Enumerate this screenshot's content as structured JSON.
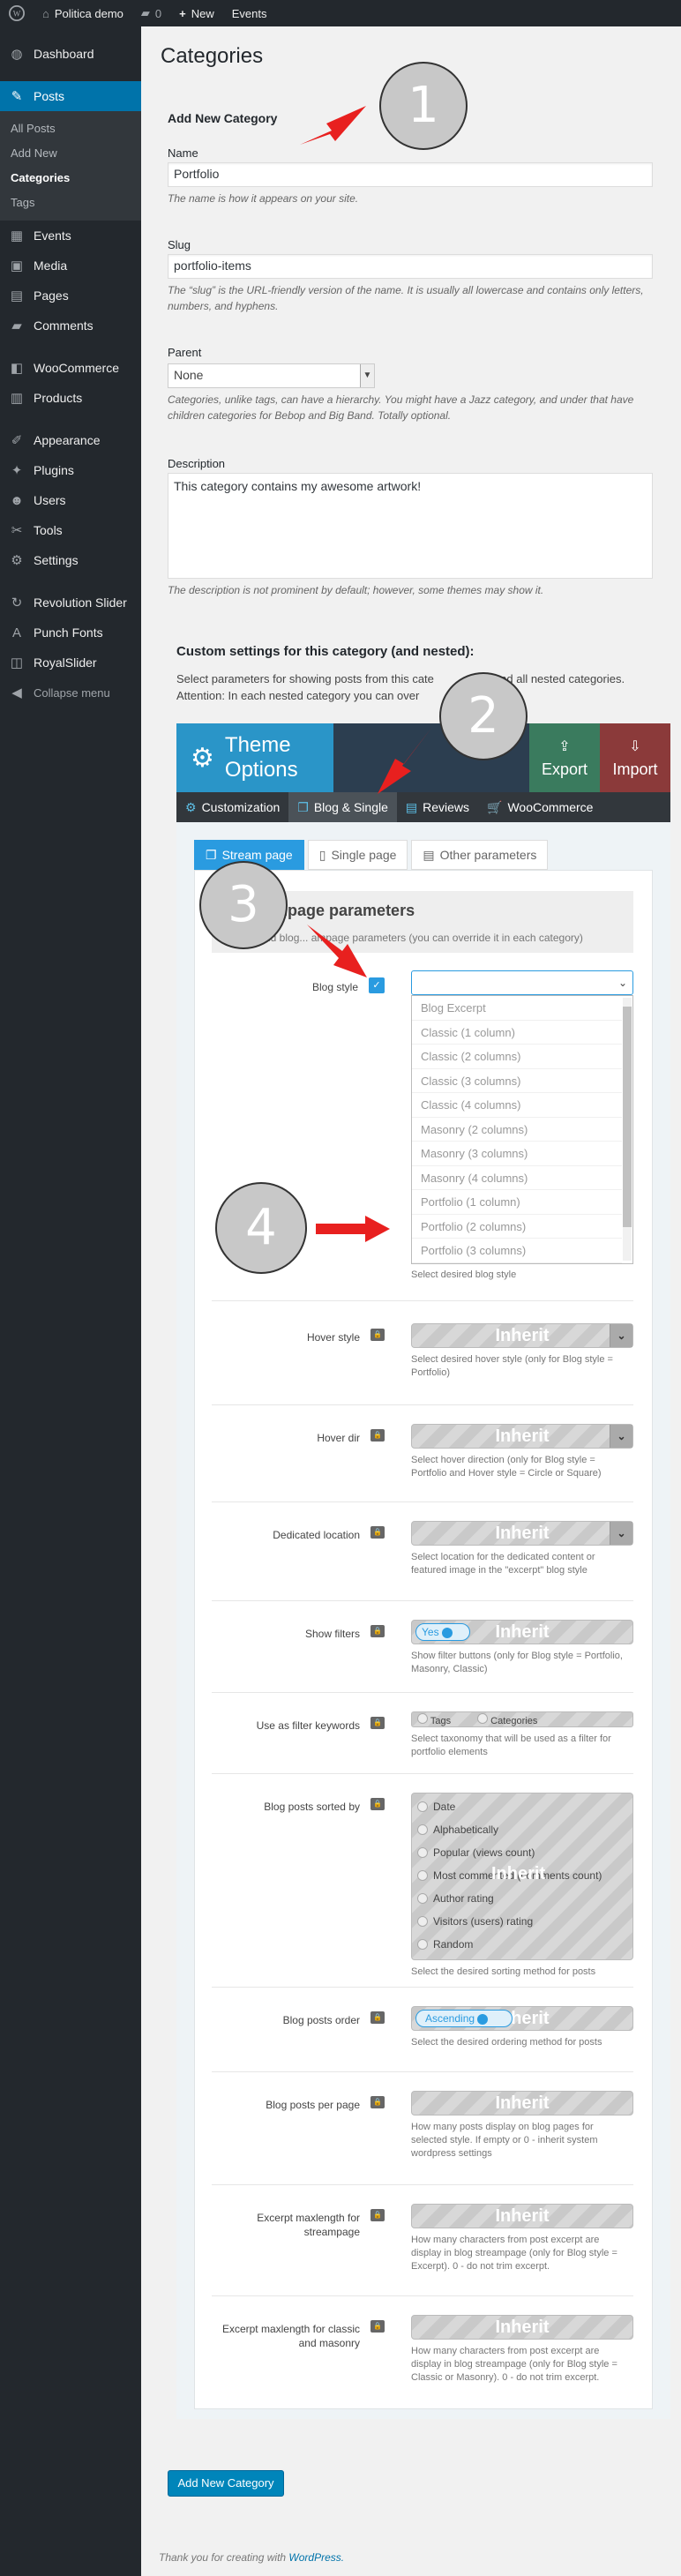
{
  "adminbar": {
    "site_name": "Politica demo",
    "comments_count": "0",
    "new_label": "New",
    "events_label": "Events"
  },
  "sidebar": {
    "items": [
      {
        "label": "Dashboard",
        "icon": "dashboard-icon"
      },
      {
        "label": "Posts",
        "icon": "pin-icon"
      },
      {
        "label": "Events",
        "icon": "calendar-icon"
      },
      {
        "label": "Media",
        "icon": "media-icon"
      },
      {
        "label": "Pages",
        "icon": "page-icon"
      },
      {
        "label": "Comments",
        "icon": "comment-icon"
      },
      {
        "label": "WooCommerce",
        "icon": "woo-icon"
      },
      {
        "label": "Products",
        "icon": "box-icon"
      },
      {
        "label": "Appearance",
        "icon": "brush-icon"
      },
      {
        "label": "Plugins",
        "icon": "plug-icon"
      },
      {
        "label": "Users",
        "icon": "user-icon"
      },
      {
        "label": "Tools",
        "icon": "wrench-icon"
      },
      {
        "label": "Settings",
        "icon": "settings-icon"
      },
      {
        "label": "Revolution Slider",
        "icon": "refresh-icon"
      },
      {
        "label": "Punch Fonts",
        "icon": "font-icon"
      },
      {
        "label": "RoyalSlider",
        "icon": "slider-icon"
      },
      {
        "label": "Collapse menu",
        "icon": "collapse-icon"
      }
    ],
    "submenu": [
      "All Posts",
      "Add New",
      "Categories",
      "Tags"
    ]
  },
  "page": {
    "title": "Categories",
    "add_heading": "Add New Category",
    "name_label": "Name",
    "name_value": "Portfolio",
    "name_desc": "The name is how it appears on your site.",
    "slug_label": "Slug",
    "slug_value": "portfolio-items",
    "slug_desc_1": "The “slug” is the URL-friendly version of the name. It is usually all lowercase and contains only letters,",
    "slug_desc_2": "numbers, and hyphens.",
    "parent_label": "Parent",
    "parent_value": "None",
    "parent_desc_1": "Categories, unlike tags, can have a hierarchy. You might have a Jazz category, and under that have",
    "parent_desc_2": "children categories for Bebop and Big Band. Totally optional.",
    "description_label": "Description",
    "description_value": "This category contains my awesome artwork!",
    "description_desc": "The description is not prominent by default; however, some themes may show it.",
    "custom_heading": "Custom settings for this category (and nested):",
    "custom_desc_1": "Select parameters for showing posts from this cate",
    "custom_desc_1b": "and all nested categories.",
    "custom_desc_2": "Attention: In each nested category you can over",
    "custom_desc_2b": "ngs.",
    "submit_label": "Add New Category",
    "footer_text": "Thank you for creating with ",
    "footer_link": "WordPress."
  },
  "theme_options": {
    "title_1": "Theme",
    "title_2": "Options",
    "export_label": "Export",
    "import_label": "Import",
    "tabs": [
      "Customization",
      "Blog & Single",
      "Reviews",
      "WooCommerce"
    ],
    "subtabs": [
      "Stream page",
      "Single page",
      "Other parameters"
    ],
    "section_title": "ampage parameters",
    "section_sub": "nd blog... ampage parameters (you can override it in each category)",
    "blog_style_label": "Blog style",
    "blog_style_desc": "Select desired blog style",
    "blog_style_options": [
      "Blog Excerpt",
      "Classic (1 column)",
      "Classic (2 columns)",
      "Classic (3 columns)",
      "Classic (4 columns)",
      "Masonry (2 columns)",
      "Masonry (3 columns)",
      "Masonry (4 columns)",
      "Portfolio (1 column)",
      "Portfolio (2 columns)",
      "Portfolio (3 columns)"
    ],
    "inherit_label": "Inherit",
    "rows": [
      {
        "label": "Hover style",
        "desc": "Select desired hover style (only for Blog style = Portfolio)"
      },
      {
        "label": "Hover dir",
        "desc": "Select hover direction (only for Blog style = Portfolio and Hover style = Circle or Square)"
      },
      {
        "label": "Dedicated location",
        "desc": "Select location for the dedicated content or featured image in the \"excerpt\" blog style"
      },
      {
        "label": "Show filters",
        "desc": "Show filter buttons (only for Blog style = Portfolio, Masonry, Classic)"
      },
      {
        "label": "Use as filter keywords",
        "desc": "Select taxonomy that will be used as a filter for portfolio elements"
      },
      {
        "label": "Blog posts sorted by",
        "desc": "Select the desired sorting method for posts"
      },
      {
        "label": "Blog posts order",
        "desc": "Select the desired ordering method for posts"
      },
      {
        "label": "Blog posts per page",
        "desc": "How many posts display on blog pages for selected style. If empty or 0 - inherit system wordpress settings"
      },
      {
        "label": "Excerpt maxlength for streampage",
        "desc": "How many characters from post excerpt are display in blog streampage (only for Blog style = Excerpt). 0 - do not trim excerpt."
      },
      {
        "label": "Excerpt maxlength for classic and masonry",
        "desc": "How many characters from post excerpt are display in blog streampage (only for Blog style = Classic or Masonry). 0 - do not trim excerpt."
      }
    ],
    "show_filters_value": "Yes",
    "filter_keywords": [
      "Tags",
      "Categories"
    ],
    "sort_options": [
      "Date",
      "Alphabetically",
      "Popular (views count)",
      "Most commented (comments count)",
      "Author rating",
      "Visitors (users) rating",
      "Random"
    ],
    "order_value": "Ascending"
  },
  "annotations": [
    "1",
    "2",
    "3",
    "4"
  ],
  "colors": {
    "accent": "#0073aa",
    "theme_blue": "#1e8cbe",
    "export_green": "#3a7b5e",
    "import_red": "#8b3a3a",
    "arrow_red": "#e8201f"
  }
}
